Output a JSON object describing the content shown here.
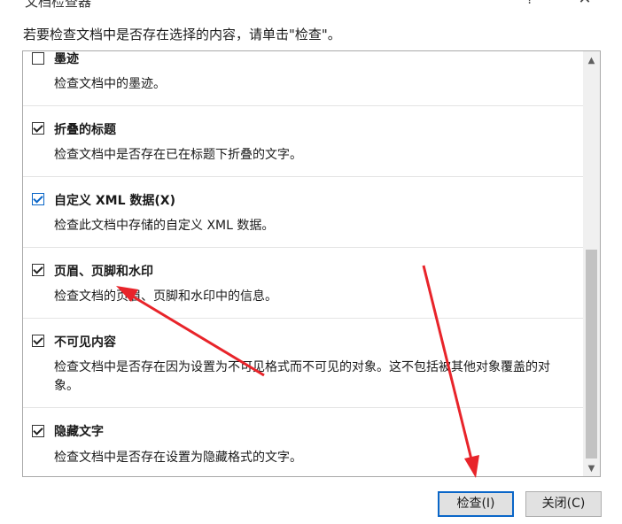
{
  "window": {
    "title": "文档检查器",
    "help_glyph": "?",
    "close_glyph": "✕"
  },
  "instruction": "若要检查文档中是否存在选择的内容，请单击\"检查\"。",
  "items": [
    {
      "label": "墨迹",
      "description": "检查文档中的墨迹。",
      "checked": false
    },
    {
      "label": "折叠的标题",
      "description": "检查文档中是否存在已在标题下折叠的文字。",
      "checked": true
    },
    {
      "label": "自定义 XML 数据(X)",
      "description": "检查此文档中存储的自定义 XML 数据。",
      "checked": true
    },
    {
      "label": "页眉、页脚和水印",
      "description": "检查文档的页眉、页脚和水印中的信息。",
      "checked": true
    },
    {
      "label": "不可见内容",
      "description": "检查文档中是否存在因为设置为不可见格式而不可见的对象。这不包括被其他对象覆盖的对象。",
      "checked": true
    },
    {
      "label": "隐藏文字",
      "description": "检查文档中是否存在设置为隐藏格式的文字。",
      "checked": true
    }
  ],
  "scrollbar": {
    "up_glyph": "▲",
    "down_glyph": "▼"
  },
  "buttons": {
    "inspect": "检查(I)",
    "close": "关闭(C)"
  },
  "colors": {
    "annotation_arrow": "#e8242a",
    "focus_blue": "#0a66c8"
  }
}
